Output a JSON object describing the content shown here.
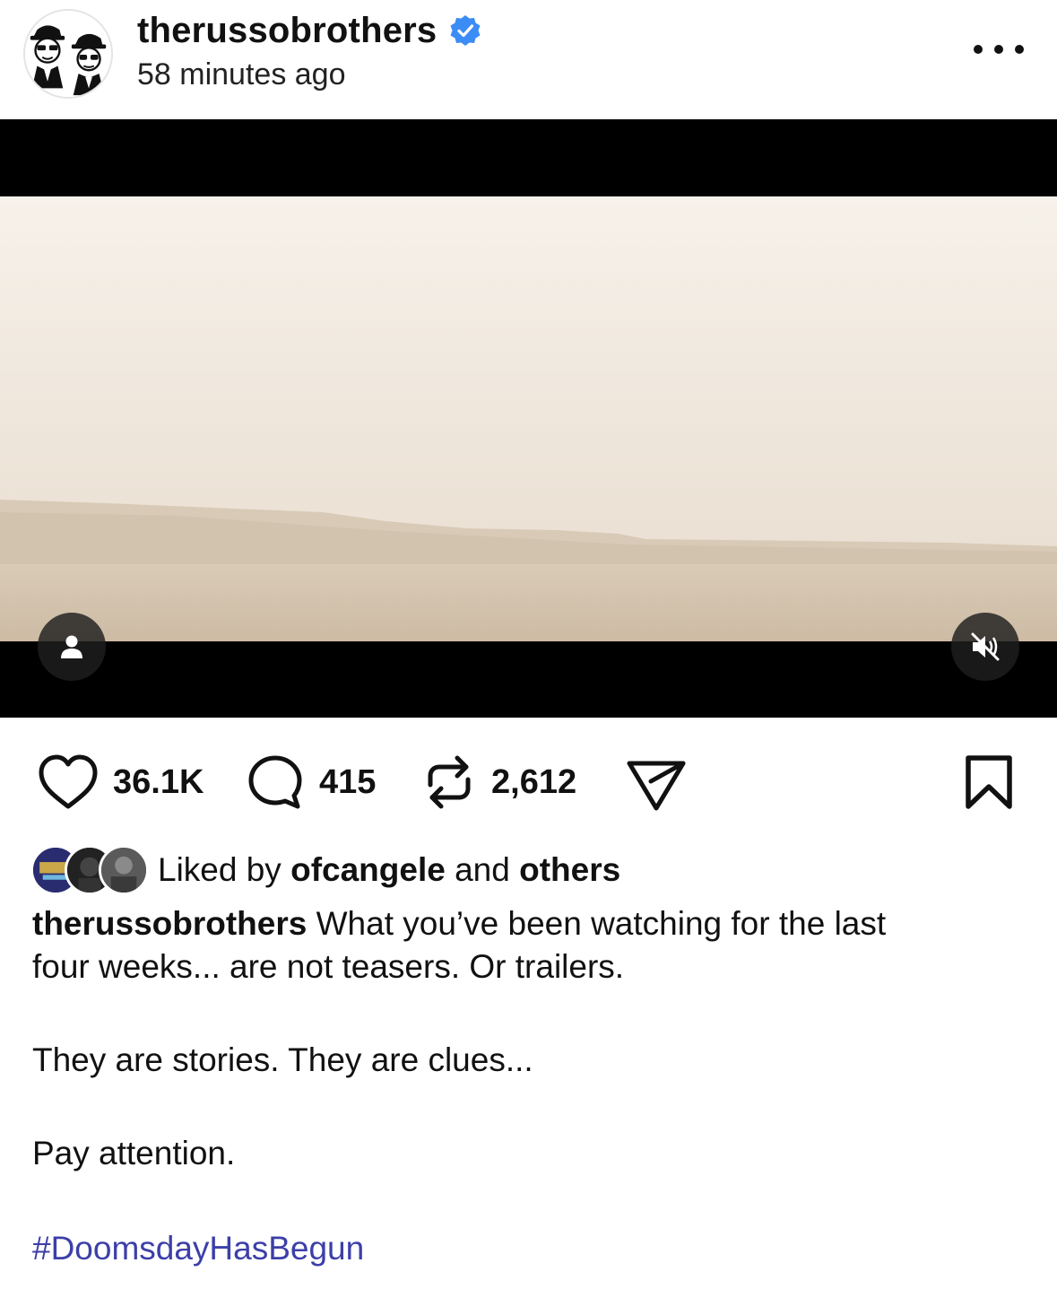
{
  "post": {
    "username": "therussobrothers",
    "verified": true,
    "timestamp": "58 minutes ago",
    "more_icon": "more-horizontal-icon"
  },
  "media": {
    "tag_icon": "user-tag-icon",
    "mute_icon": "speaker-muted-icon"
  },
  "actions": {
    "likes": "36.1K",
    "comments": "415",
    "reposts": "2,612",
    "icons": [
      "heart-icon",
      "comment-icon",
      "repost-icon",
      "share-icon",
      "bookmark-icon"
    ]
  },
  "liked_by": {
    "prefix": "Liked by ",
    "user": "ofcangele",
    "middle": " and ",
    "others": "others"
  },
  "caption": {
    "user": "therussobrothers",
    "line1_rest": " What you’ve been watching for the last",
    "line2": "four weeks... are not teasers. Or trailers.",
    "para2": "They are stories. They are clues...",
    "para3": "Pay attention.",
    "hashtag": "#DoomsdayHasBegun"
  },
  "colors": {
    "verified_blue": "#3b8cf5",
    "hashtag": "#3c3fa8",
    "text": "#111111"
  }
}
